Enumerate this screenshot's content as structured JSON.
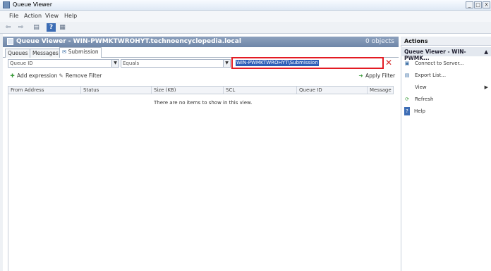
{
  "window": {
    "title": "Queue Viewer",
    "buttons": [
      "_",
      "□",
      "X"
    ]
  },
  "menu": [
    "File",
    "Action",
    "View",
    "Help"
  ],
  "toolbar": {
    "icons": [
      "back-icon",
      "forward-icon",
      "console-tree-icon",
      "help-icon",
      "properties-icon"
    ],
    "glyphs": [
      "⇦",
      "⇨",
      "▤",
      "?",
      "▦"
    ]
  },
  "main": {
    "title": "Queue Viewer - WIN-PWMKTWROHYT.technoencyclopedia.local",
    "count": "0 objects",
    "tabs": [
      "Queues",
      "Messages",
      "Submission"
    ]
  },
  "filter": {
    "field": "Queue ID",
    "operator": "Equals",
    "value": "WIN-PWMKTWROHYT\\Submission",
    "remove_glyph": "✕"
  },
  "expression": {
    "add_label": "Add expression",
    "remove_label": "Remove Filter",
    "apply_label": "Apply Filter"
  },
  "grid": {
    "columns": [
      "From Address",
      "Status",
      "Size (KB)",
      "SCL",
      "Queue ID",
      "Message S"
    ],
    "empty_message": "There are no items to show in this view."
  },
  "actions": {
    "header": "Actions",
    "section": "Queue Viewer - WIN-PWMK...",
    "items": [
      {
        "label": "Connect to Server...",
        "icon": "server-icon"
      },
      {
        "label": "Export List...",
        "icon": "export-icon"
      },
      {
        "label": "View",
        "icon": "view-icon"
      },
      {
        "label": "Refresh",
        "icon": "refresh-icon"
      },
      {
        "label": "Help",
        "icon": "help-icon"
      }
    ]
  }
}
